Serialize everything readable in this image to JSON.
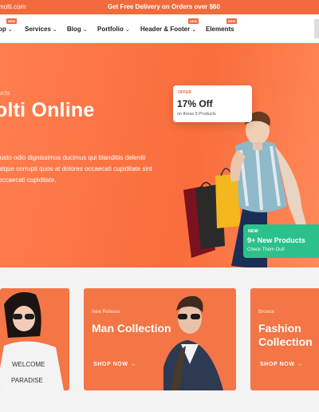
{
  "topbar": {
    "email": "molti.com",
    "promo": "Get Free Delivery on Orders over $60"
  },
  "nav": {
    "items": [
      {
        "label": "op",
        "badge": "NEW"
      },
      {
        "label": "Services",
        "badge": ""
      },
      {
        "label": "Blog",
        "badge": ""
      },
      {
        "label": "Portfolio",
        "badge": ""
      },
      {
        "label": "Header & Footer",
        "badge": "NEW"
      },
      {
        "label": "Elements",
        "badge": "NEW"
      }
    ]
  },
  "hero": {
    "kicker": "ucts",
    "title": "olti Online",
    "description": "justo odio dignissimos ducimus qui blanditiis deleniti atque corrupti quos at dolores occaecati cupiditate sint occaecati cupiditate.",
    "offer": {
      "tag": "OFFER",
      "amount": "17% Off",
      "subtitle": "on these 5 Products"
    },
    "new_products": {
      "tag": "NEW",
      "title": "9+ New Products",
      "subtitle": "Check Them Out!"
    }
  },
  "cards": [
    {
      "kicker": "",
      "title": "",
      "link": ""
    },
    {
      "kicker": "New Release",
      "title": "Man Collection",
      "link": "SHOP NOW →"
    },
    {
      "kicker": "Browse",
      "title": "Fashion Collection",
      "link": "SHOP NOW →"
    }
  ],
  "colors": {
    "accent": "#f26a3c",
    "green": "#2cc18a"
  }
}
